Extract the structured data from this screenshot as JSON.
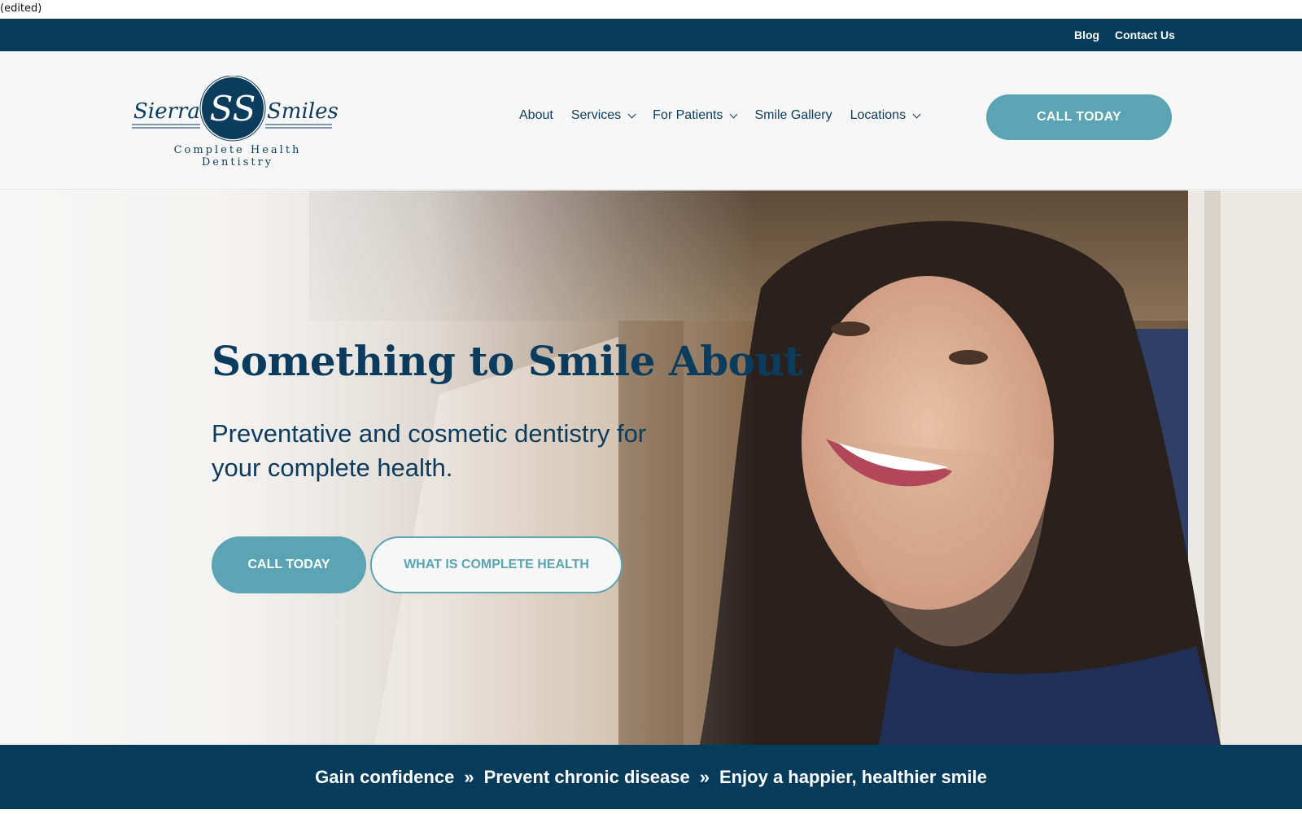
{
  "page_note": "(edited)",
  "top_bar": {
    "links": [
      "Blog",
      "Contact Us"
    ],
    "background": "#053b5b"
  },
  "header": {
    "logo": {
      "left_word": "Sierra",
      "right_word": "Smiles",
      "monogram": "SS",
      "tagline": "Complete Health Dentistry"
    },
    "nav": [
      {
        "label": "About",
        "has_dropdown": false
      },
      {
        "label": "Services",
        "has_dropdown": true
      },
      {
        "label": "For Patients",
        "has_dropdown": true
      },
      {
        "label": "Smile Gallery",
        "has_dropdown": false
      },
      {
        "label": "Locations",
        "has_dropdown": true
      }
    ],
    "cta_label": "CALL TODAY"
  },
  "hero": {
    "title": "Something to Smile About",
    "subtitle": "Preventative and cosmetic dentistry for your complete health.",
    "primary_button": "CALL TODAY",
    "secondary_button": "WHAT IS COMPLETE HEALTH"
  },
  "benefits": {
    "items": [
      "Gain confidence",
      "Prevent chronic disease",
      "Enjoy a happier, healthier smile"
    ],
    "separator": "»"
  },
  "colors": {
    "navy": "#053b5b",
    "teal": "#5ba4b3",
    "header_bg": "#f7f7f7"
  }
}
